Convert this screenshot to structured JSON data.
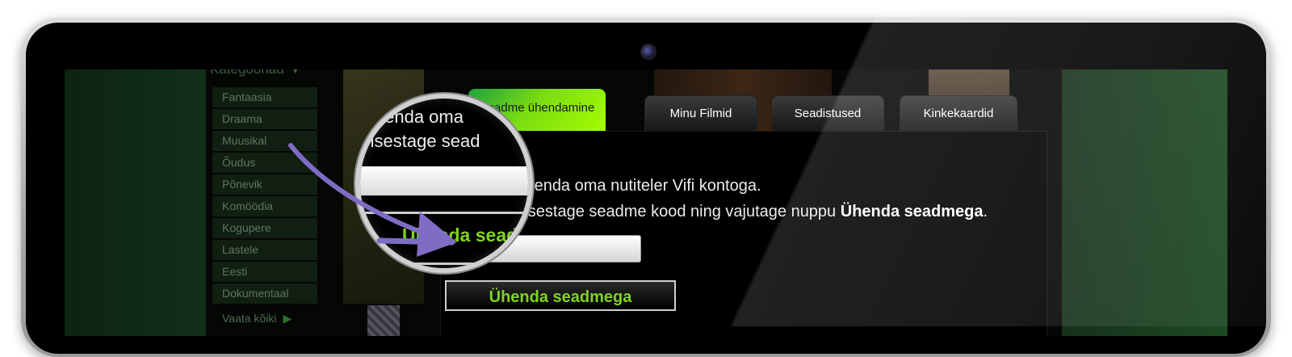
{
  "categories": {
    "header": "Kategooriad",
    "items": [
      "Fantaasia",
      "Draama",
      "Muusikal",
      "Õudus",
      "Põnevik",
      "Komöödia",
      "Kogupere",
      "Lastele",
      "Eesti",
      "Dokumentaal"
    ],
    "view_all": "Vaata kõiki"
  },
  "tabs": [
    {
      "label": "Seadme ühendamine",
      "active": true
    },
    {
      "label": "Minu Filmid",
      "active": false
    },
    {
      "label": "Seadistused",
      "active": false
    },
    {
      "label": "Kinkekaardid",
      "active": false
    }
  ],
  "panel": {
    "instruction_line1": "Ühenda oma nutiteler Vifi kontoga.",
    "instruction_line2_prefix": "Sisestage seadme kood ning vajutage nuppu ",
    "instruction_line2_bold": "Ühenda seadmega",
    "instruction_line2_suffix": ".",
    "code_input_value": "",
    "connect_button_label": "Ühenda seadmega"
  },
  "magnifier": {
    "line1": "Ühenda oma",
    "line2": "Sisestage sead",
    "button_text": "Ühenda seadmega"
  },
  "colors": {
    "active_tab_gradient": [
      "#1aa43c",
      "#a6ff00"
    ],
    "button_text": "#7fd31f",
    "arrow": "#7f6cc4"
  }
}
